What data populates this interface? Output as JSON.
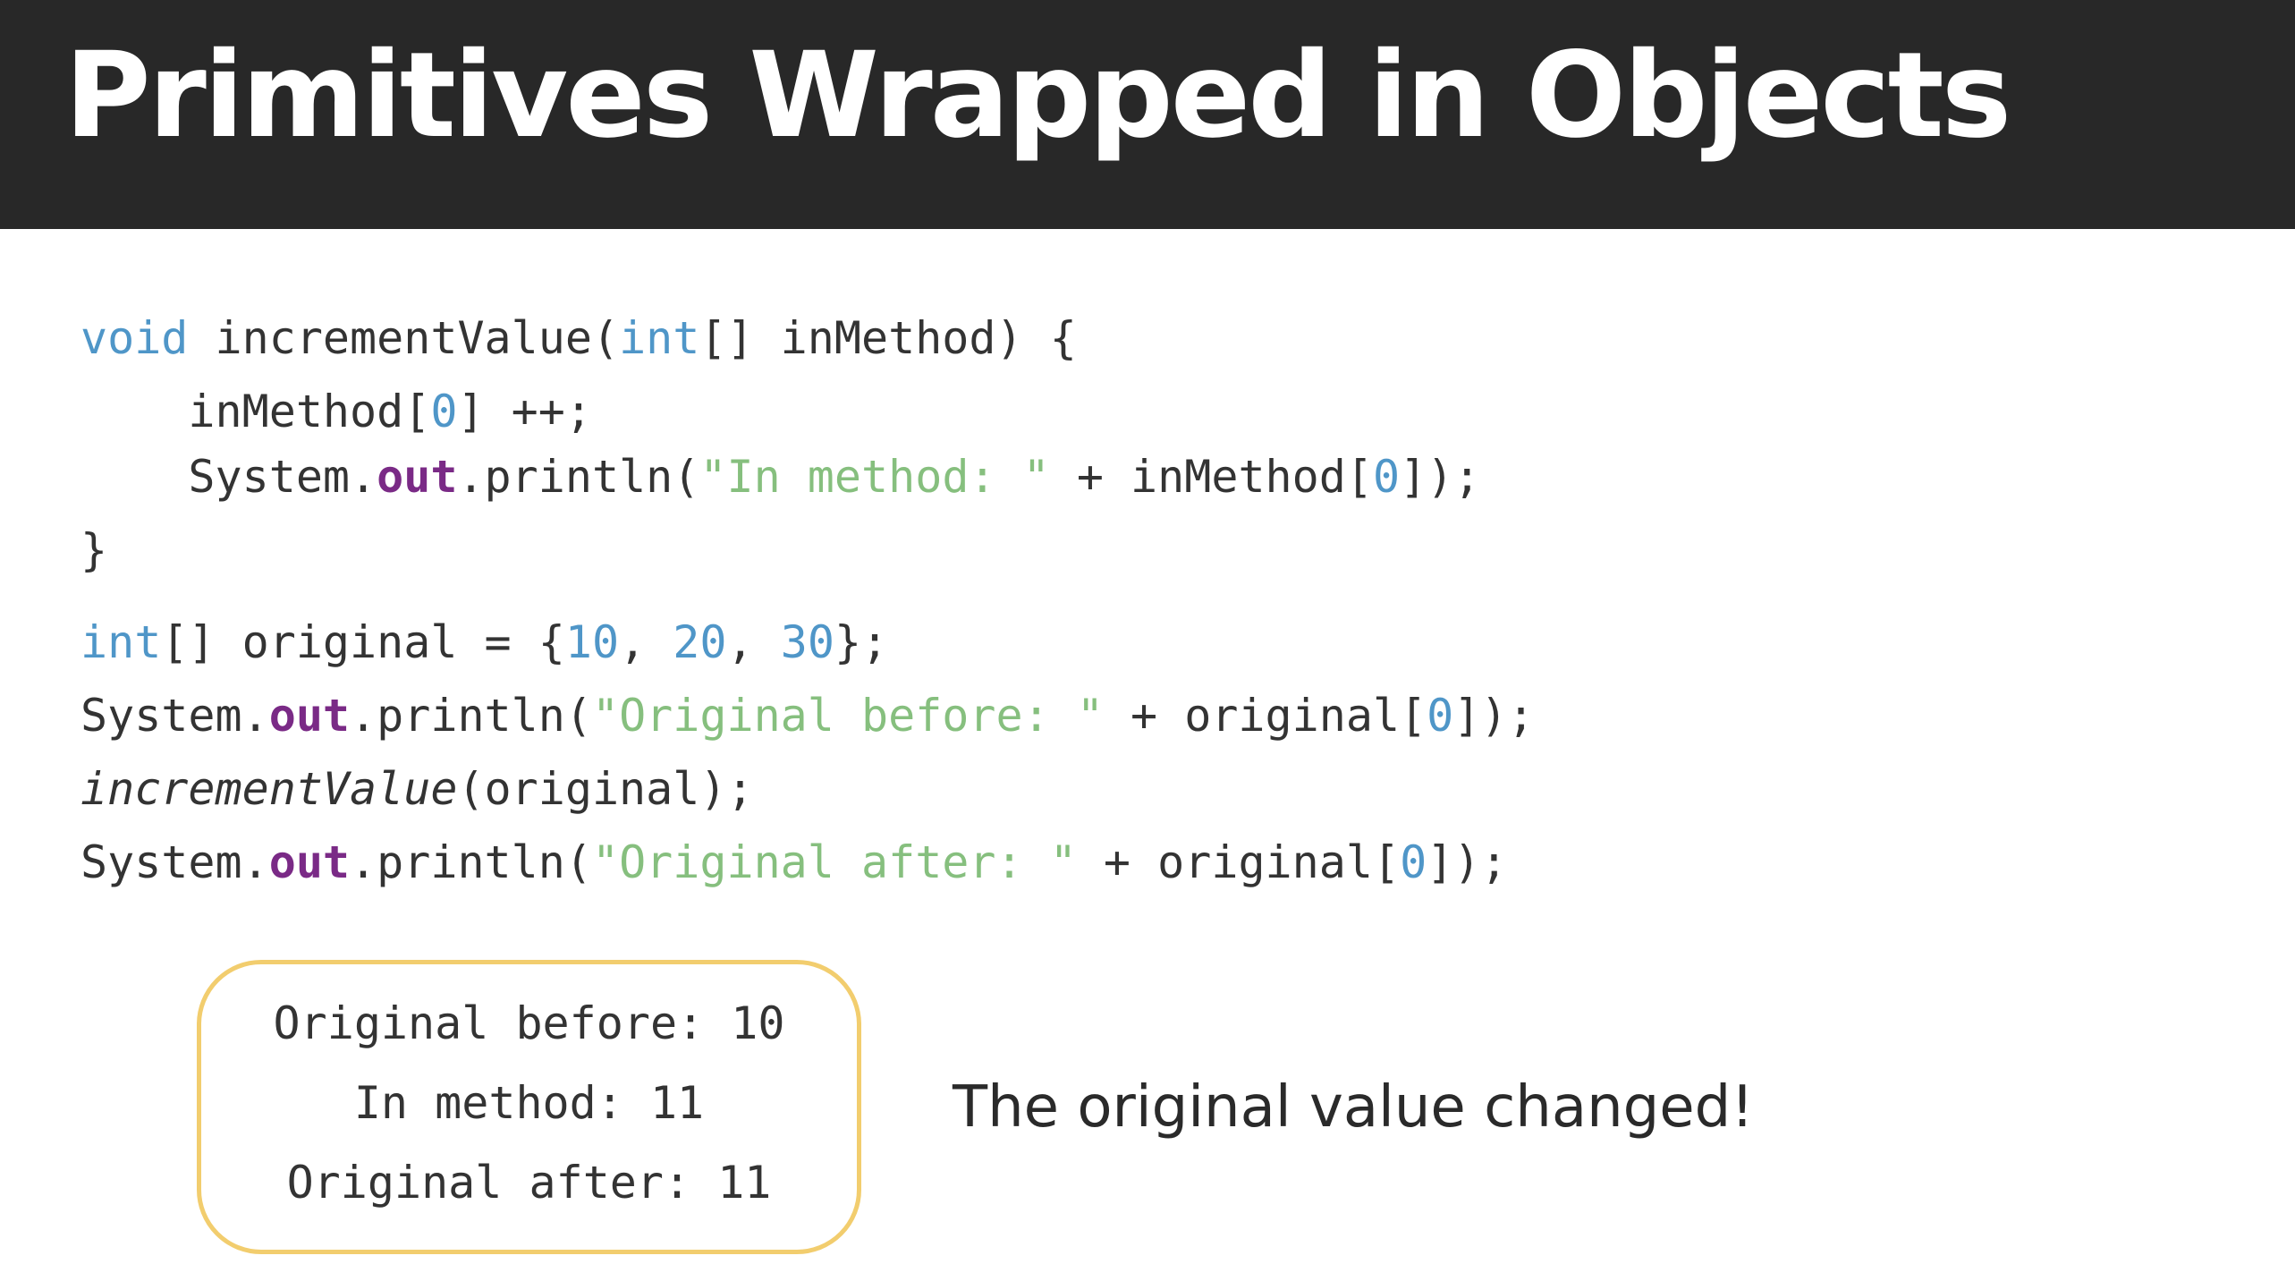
{
  "slide": {
    "title": "Primitives Wrapped in Objects",
    "caption": "The original value changed!"
  },
  "code": {
    "line1": {
      "kw_void": "void",
      "name": " incrementValue(",
      "kw_int": "int",
      "rest": "[] inMethod) {"
    },
    "line2": {
      "a": "    inMethod[",
      "n0": "0",
      "b": "] ++;"
    },
    "line3": {
      "a": "    System.",
      "out": "out",
      "b": ".println(",
      "str": "\"In method: \"",
      "c": " + inMethod[",
      "n0": "0",
      "d": "]);"
    },
    "line4": {
      "a": "}"
    },
    "line5": {
      "kw_int": "int",
      "a": "[] original = {",
      "n1": "10",
      "s1": ", ",
      "n2": "20",
      "s2": ", ",
      "n3": "30",
      "b": "};"
    },
    "line6": {
      "a": "System.",
      "out": "out",
      "b": ".println(",
      "str": "\"Original before: \"",
      "c": " + original[",
      "n0": "0",
      "d": "]);"
    },
    "line7": {
      "fn": "incrementValue",
      "a": "(original);"
    },
    "line8": {
      "a": "System.",
      "out": "out",
      "b": ".println(",
      "str": "\"Original after: \"",
      "c": " + original[",
      "n0": "0",
      "d": "]);"
    }
  },
  "output": {
    "lines": [
      "Original before: 10",
      "In method: 11",
      "Original after: 11"
    ]
  },
  "colors": {
    "title_bar": "#282828",
    "keyword": "#4f96c8",
    "field": "#7a2a86",
    "string": "#86bf7e",
    "output_border": "#f2cd6e"
  }
}
